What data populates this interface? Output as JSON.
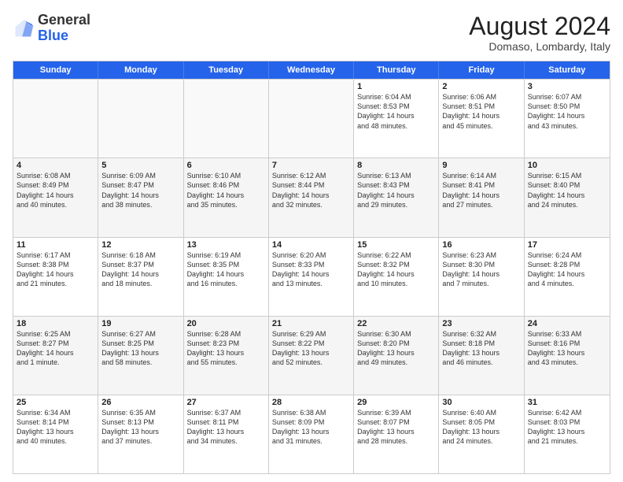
{
  "header": {
    "logo_general": "General",
    "logo_blue": "Blue",
    "month_year": "August 2024",
    "location": "Domaso, Lombardy, Italy"
  },
  "calendar": {
    "days": [
      "Sunday",
      "Monday",
      "Tuesday",
      "Wednesday",
      "Thursday",
      "Friday",
      "Saturday"
    ],
    "rows": [
      [
        {
          "day": "",
          "empty": true
        },
        {
          "day": "",
          "empty": true
        },
        {
          "day": "",
          "empty": true
        },
        {
          "day": "",
          "empty": true
        },
        {
          "day": "1",
          "lines": [
            "Sunrise: 6:04 AM",
            "Sunset: 8:53 PM",
            "Daylight: 14 hours",
            "and 48 minutes."
          ]
        },
        {
          "day": "2",
          "lines": [
            "Sunrise: 6:06 AM",
            "Sunset: 8:51 PM",
            "Daylight: 14 hours",
            "and 45 minutes."
          ]
        },
        {
          "day": "3",
          "lines": [
            "Sunrise: 6:07 AM",
            "Sunset: 8:50 PM",
            "Daylight: 14 hours",
            "and 43 minutes."
          ]
        }
      ],
      [
        {
          "day": "4",
          "lines": [
            "Sunrise: 6:08 AM",
            "Sunset: 8:49 PM",
            "Daylight: 14 hours",
            "and 40 minutes."
          ]
        },
        {
          "day": "5",
          "lines": [
            "Sunrise: 6:09 AM",
            "Sunset: 8:47 PM",
            "Daylight: 14 hours",
            "and 38 minutes."
          ]
        },
        {
          "day": "6",
          "lines": [
            "Sunrise: 6:10 AM",
            "Sunset: 8:46 PM",
            "Daylight: 14 hours",
            "and 35 minutes."
          ]
        },
        {
          "day": "7",
          "lines": [
            "Sunrise: 6:12 AM",
            "Sunset: 8:44 PM",
            "Daylight: 14 hours",
            "and 32 minutes."
          ]
        },
        {
          "day": "8",
          "lines": [
            "Sunrise: 6:13 AM",
            "Sunset: 8:43 PM",
            "Daylight: 14 hours",
            "and 29 minutes."
          ]
        },
        {
          "day": "9",
          "lines": [
            "Sunrise: 6:14 AM",
            "Sunset: 8:41 PM",
            "Daylight: 14 hours",
            "and 27 minutes."
          ]
        },
        {
          "day": "10",
          "lines": [
            "Sunrise: 6:15 AM",
            "Sunset: 8:40 PM",
            "Daylight: 14 hours",
            "and 24 minutes."
          ]
        }
      ],
      [
        {
          "day": "11",
          "lines": [
            "Sunrise: 6:17 AM",
            "Sunset: 8:38 PM",
            "Daylight: 14 hours",
            "and 21 minutes."
          ]
        },
        {
          "day": "12",
          "lines": [
            "Sunrise: 6:18 AM",
            "Sunset: 8:37 PM",
            "Daylight: 14 hours",
            "and 18 minutes."
          ]
        },
        {
          "day": "13",
          "lines": [
            "Sunrise: 6:19 AM",
            "Sunset: 8:35 PM",
            "Daylight: 14 hours",
            "and 16 minutes."
          ]
        },
        {
          "day": "14",
          "lines": [
            "Sunrise: 6:20 AM",
            "Sunset: 8:33 PM",
            "Daylight: 14 hours",
            "and 13 minutes."
          ]
        },
        {
          "day": "15",
          "lines": [
            "Sunrise: 6:22 AM",
            "Sunset: 8:32 PM",
            "Daylight: 14 hours",
            "and 10 minutes."
          ]
        },
        {
          "day": "16",
          "lines": [
            "Sunrise: 6:23 AM",
            "Sunset: 8:30 PM",
            "Daylight: 14 hours",
            "and 7 minutes."
          ]
        },
        {
          "day": "17",
          "lines": [
            "Sunrise: 6:24 AM",
            "Sunset: 8:28 PM",
            "Daylight: 14 hours",
            "and 4 minutes."
          ]
        }
      ],
      [
        {
          "day": "18",
          "lines": [
            "Sunrise: 6:25 AM",
            "Sunset: 8:27 PM",
            "Daylight: 14 hours",
            "and 1 minute."
          ]
        },
        {
          "day": "19",
          "lines": [
            "Sunrise: 6:27 AM",
            "Sunset: 8:25 PM",
            "Daylight: 13 hours",
            "and 58 minutes."
          ]
        },
        {
          "day": "20",
          "lines": [
            "Sunrise: 6:28 AM",
            "Sunset: 8:23 PM",
            "Daylight: 13 hours",
            "and 55 minutes."
          ]
        },
        {
          "day": "21",
          "lines": [
            "Sunrise: 6:29 AM",
            "Sunset: 8:22 PM",
            "Daylight: 13 hours",
            "and 52 minutes."
          ]
        },
        {
          "day": "22",
          "lines": [
            "Sunrise: 6:30 AM",
            "Sunset: 8:20 PM",
            "Daylight: 13 hours",
            "and 49 minutes."
          ]
        },
        {
          "day": "23",
          "lines": [
            "Sunrise: 6:32 AM",
            "Sunset: 8:18 PM",
            "Daylight: 13 hours",
            "and 46 minutes."
          ]
        },
        {
          "day": "24",
          "lines": [
            "Sunrise: 6:33 AM",
            "Sunset: 8:16 PM",
            "Daylight: 13 hours",
            "and 43 minutes."
          ]
        }
      ],
      [
        {
          "day": "25",
          "lines": [
            "Sunrise: 6:34 AM",
            "Sunset: 8:14 PM",
            "Daylight: 13 hours",
            "and 40 minutes."
          ]
        },
        {
          "day": "26",
          "lines": [
            "Sunrise: 6:35 AM",
            "Sunset: 8:13 PM",
            "Daylight: 13 hours",
            "and 37 minutes."
          ]
        },
        {
          "day": "27",
          "lines": [
            "Sunrise: 6:37 AM",
            "Sunset: 8:11 PM",
            "Daylight: 13 hours",
            "and 34 minutes."
          ]
        },
        {
          "day": "28",
          "lines": [
            "Sunrise: 6:38 AM",
            "Sunset: 8:09 PM",
            "Daylight: 13 hours",
            "and 31 minutes."
          ]
        },
        {
          "day": "29",
          "lines": [
            "Sunrise: 6:39 AM",
            "Sunset: 8:07 PM",
            "Daylight: 13 hours",
            "and 28 minutes."
          ]
        },
        {
          "day": "30",
          "lines": [
            "Sunrise: 6:40 AM",
            "Sunset: 8:05 PM",
            "Daylight: 13 hours",
            "and 24 minutes."
          ]
        },
        {
          "day": "31",
          "lines": [
            "Sunrise: 6:42 AM",
            "Sunset: 8:03 PM",
            "Daylight: 13 hours",
            "and 21 minutes."
          ]
        }
      ]
    ]
  }
}
